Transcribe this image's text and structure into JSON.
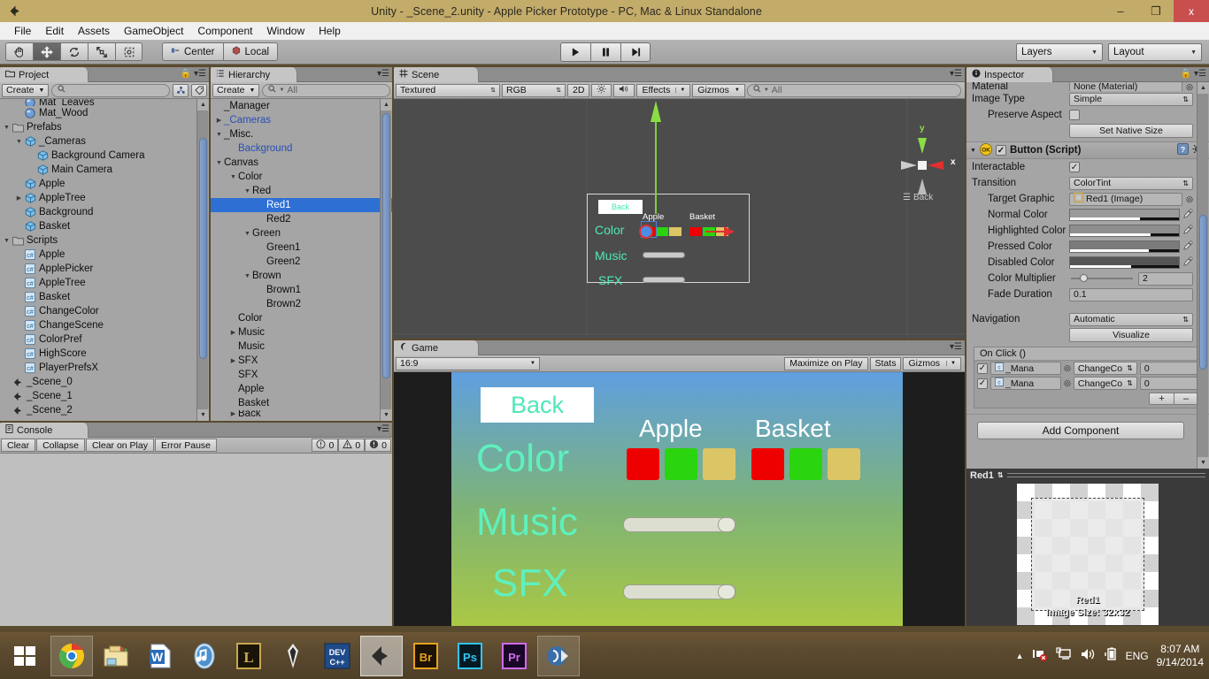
{
  "window": {
    "title": "Unity - _Scene_2.unity - Apple Picker Prototype - PC, Mac & Linux Standalone",
    "minimize": "–",
    "maximize": "❐",
    "close": "x"
  },
  "menubar": {
    "items": [
      "File",
      "Edit",
      "Assets",
      "GameObject",
      "Component",
      "Window",
      "Help"
    ]
  },
  "toolbar": {
    "tools": [
      "hand-tool",
      "move-tool",
      "rotate-tool",
      "scale-tool",
      "rect-tool"
    ],
    "active_tool_index": 1,
    "pivot_mode": "Center",
    "pivot_space": "Local",
    "play": "play-icon",
    "pause": "pause-icon",
    "step": "step-icon",
    "layers": "Layers",
    "layout": "Layout"
  },
  "project": {
    "tab": "Project",
    "create_label": "Create",
    "search_placeholder": "",
    "items": [
      {
        "label": "Mat_Leaves",
        "depth": 1,
        "icon": "material-icon",
        "twirl": "",
        "clipped": true
      },
      {
        "label": "Mat_Wood",
        "depth": 1,
        "icon": "material-icon",
        "twirl": ""
      },
      {
        "label": "Prefabs",
        "depth": 0,
        "icon": "folder-icon",
        "twirl": "▼"
      },
      {
        "label": "_Cameras",
        "depth": 1,
        "icon": "prefab-icon",
        "twirl": "▼"
      },
      {
        "label": "Background Camera",
        "depth": 2,
        "icon": "prefab-icon",
        "twirl": ""
      },
      {
        "label": "Main Camera",
        "depth": 2,
        "icon": "prefab-icon",
        "twirl": ""
      },
      {
        "label": "Apple",
        "depth": 1,
        "icon": "prefab-icon",
        "twirl": ""
      },
      {
        "label": "AppleTree",
        "depth": 1,
        "icon": "prefab-icon",
        "twirl": "▶"
      },
      {
        "label": "Background",
        "depth": 1,
        "icon": "prefab-icon",
        "twirl": ""
      },
      {
        "label": "Basket",
        "depth": 1,
        "icon": "prefab-icon",
        "twirl": ""
      },
      {
        "label": "Scripts",
        "depth": 0,
        "icon": "folder-icon",
        "twirl": "▼"
      },
      {
        "label": "Apple",
        "depth": 1,
        "icon": "csharp-icon",
        "twirl": ""
      },
      {
        "label": "ApplePicker",
        "depth": 1,
        "icon": "csharp-icon",
        "twirl": ""
      },
      {
        "label": "AppleTree",
        "depth": 1,
        "icon": "csharp-icon",
        "twirl": ""
      },
      {
        "label": "Basket",
        "depth": 1,
        "icon": "csharp-icon",
        "twirl": ""
      },
      {
        "label": "ChangeColor",
        "depth": 1,
        "icon": "csharp-icon",
        "twirl": ""
      },
      {
        "label": "ChangeScene",
        "depth": 1,
        "icon": "csharp-icon",
        "twirl": ""
      },
      {
        "label": "ColorPref",
        "depth": 1,
        "icon": "csharp-icon",
        "twirl": ""
      },
      {
        "label": "HighScore",
        "depth": 1,
        "icon": "csharp-icon",
        "twirl": ""
      },
      {
        "label": "PlayerPrefsX",
        "depth": 1,
        "icon": "csharp-icon",
        "twirl": ""
      },
      {
        "label": "_Scene_0",
        "depth": 0,
        "icon": "unity-scene-icon",
        "twirl": ""
      },
      {
        "label": "_Scene_1",
        "depth": 0,
        "icon": "unity-scene-icon",
        "twirl": ""
      },
      {
        "label": "_Scene_2",
        "depth": 0,
        "icon": "unity-scene-icon",
        "twirl": ""
      }
    ]
  },
  "hierarchy": {
    "tab": "Hierarchy",
    "create_label": "Create",
    "search_placeholder": "All",
    "items": [
      {
        "label": "_Manager",
        "depth": 0,
        "twirl": "",
        "style": "normal"
      },
      {
        "label": "_Cameras",
        "depth": 0,
        "twirl": "▶",
        "style": "prefab"
      },
      {
        "label": "_Misc.",
        "depth": 0,
        "twirl": "▼",
        "style": "normal"
      },
      {
        "label": "Background",
        "depth": 1,
        "twirl": "",
        "style": "prefab"
      },
      {
        "label": "Canvas",
        "depth": 0,
        "twirl": "▼",
        "style": "normal"
      },
      {
        "label": "Color",
        "depth": 1,
        "twirl": "▼",
        "style": "normal"
      },
      {
        "label": "Red",
        "depth": 2,
        "twirl": "▼",
        "style": "normal"
      },
      {
        "label": "Red1",
        "depth": 3,
        "twirl": "",
        "style": "normal",
        "selected": true
      },
      {
        "label": "Red2",
        "depth": 3,
        "twirl": "",
        "style": "normal"
      },
      {
        "label": "Green",
        "depth": 2,
        "twirl": "▼",
        "style": "normal"
      },
      {
        "label": "Green1",
        "depth": 3,
        "twirl": "",
        "style": "normal"
      },
      {
        "label": "Green2",
        "depth": 3,
        "twirl": "",
        "style": "normal"
      },
      {
        "label": "Brown",
        "depth": 2,
        "twirl": "▼",
        "style": "normal"
      },
      {
        "label": "Brown1",
        "depth": 3,
        "twirl": "",
        "style": "normal"
      },
      {
        "label": "Brown2",
        "depth": 3,
        "twirl": "",
        "style": "normal"
      },
      {
        "label": "Color",
        "depth": 1,
        "twirl": "",
        "style": "normal"
      },
      {
        "label": "Music",
        "depth": 1,
        "twirl": "▶",
        "style": "normal"
      },
      {
        "label": "Music",
        "depth": 1,
        "twirl": "",
        "style": "normal"
      },
      {
        "label": "SFX",
        "depth": 1,
        "twirl": "▶",
        "style": "normal"
      },
      {
        "label": "SFX",
        "depth": 1,
        "twirl": "",
        "style": "normal"
      },
      {
        "label": "Apple",
        "depth": 1,
        "twirl": "",
        "style": "normal"
      },
      {
        "label": "Basket",
        "depth": 1,
        "twirl": "",
        "style": "normal"
      },
      {
        "label": "Back",
        "depth": 1,
        "twirl": "▶",
        "style": "normal",
        "clipped": true
      }
    ]
  },
  "scene": {
    "tab": "Scene",
    "draw_mode": "Textured",
    "color_mode": "RGB",
    "btn_2d": "2D",
    "light_icon": "sun-icon",
    "audio_icon": "speaker-icon",
    "effects": "Effects",
    "gizmos": "Gizmos",
    "search_placeholder": "All",
    "gizmo_axes": {
      "y": "y",
      "x": "x"
    },
    "gizmo_label": "Back",
    "ui_preview": {
      "back_button": "Back",
      "col_apple": "Apple",
      "col_basket": "Basket",
      "rows": [
        "Color",
        "Music",
        "SFX"
      ]
    }
  },
  "game": {
    "tab": "Game",
    "aspect": "16:9",
    "maximize_on_play": "Maximize on Play",
    "stats": "Stats",
    "gizmos": "Gizmos",
    "content": {
      "back_button": "Back",
      "col_apple": "Apple",
      "col_basket": "Basket",
      "label_color": "Color",
      "label_music": "Music",
      "label_sfx": "SFX",
      "swatches": [
        "#ee0000",
        "#2ad40f",
        "#dcc565"
      ],
      "music_value": 88,
      "sfx_value": 88,
      "text_color": "#5ef0bd"
    }
  },
  "console": {
    "tab": "Console",
    "clear": "Clear",
    "collapse": "Collapse",
    "clear_on_play": "Clear on Play",
    "error_pause": "Error Pause",
    "log_count": "0",
    "warn_count": "0",
    "error_count": "0"
  },
  "inspector": {
    "tab": "Inspector",
    "image_rows": [
      {
        "label": "Material",
        "value": "None (Material)",
        "type": "object"
      },
      {
        "label": "Image Type",
        "value": "Simple",
        "type": "enum"
      },
      {
        "label": "Preserve Aspect",
        "value": "",
        "type": "checkbox",
        "checked": false
      }
    ],
    "set_native_size": "Set Native Size",
    "component": {
      "title": "Button (Script)",
      "enabled": true,
      "icon": "script-ok-icon",
      "help_icon": "help-icon",
      "gear_icon": "gear-icon",
      "rows": [
        {
          "label": "Interactable",
          "type": "checkbox",
          "checked": true
        },
        {
          "label": "Transition",
          "type": "enum",
          "value": "ColorTint"
        },
        {
          "label": "Target Graphic",
          "type": "object",
          "value": "Red1 (Image)",
          "indent": true
        },
        {
          "label": "Normal Color",
          "type": "color",
          "value": "#9a9a9a",
          "indent": true
        },
        {
          "label": "Highlighted Color",
          "type": "color",
          "value": "#8e8e8e",
          "indent": true
        },
        {
          "label": "Pressed Color",
          "type": "color",
          "value": "#7b7b7b",
          "indent": true
        },
        {
          "label": "Disabled Color",
          "type": "color",
          "value": "#555555",
          "indent": true
        },
        {
          "label": "Color Multiplier",
          "type": "slider",
          "value": "2",
          "indent": true
        },
        {
          "label": "Fade Duration",
          "type": "text",
          "value": "0.1",
          "indent": true
        }
      ],
      "navigation_label": "Navigation",
      "navigation_value": "Automatic",
      "visualize": "Visualize",
      "onclick_title": "On Click ()",
      "onclick_rows": [
        {
          "checked": true,
          "object": "_Mana",
          "method": "ChangeCo",
          "arg": "0"
        },
        {
          "checked": true,
          "object": "_Mana",
          "method": "ChangeCo",
          "arg": "0"
        }
      ],
      "plus": "+",
      "minus": "–"
    },
    "add_component": "Add Component",
    "preview": {
      "title": "Red1",
      "asset_name": "Red1",
      "size_text": "Image Size: 32x32"
    }
  },
  "taskbar": {
    "start": "start-icon",
    "apps": [
      {
        "name": "chrome-icon",
        "state": "open"
      },
      {
        "name": "file-explorer-icon",
        "state": "normal"
      },
      {
        "name": "word-icon",
        "state": "normal"
      },
      {
        "name": "itunes-icon",
        "state": "normal"
      },
      {
        "name": "league-of-legends-icon",
        "state": "normal"
      },
      {
        "name": "skyrim-icon",
        "state": "normal"
      },
      {
        "name": "devcpp-icon",
        "state": "normal"
      },
      {
        "name": "unity-icon",
        "state": "active"
      },
      {
        "name": "bridge-icon",
        "state": "normal"
      },
      {
        "name": "photoshop-icon",
        "state": "normal"
      },
      {
        "name": "premiere-icon",
        "state": "normal"
      },
      {
        "name": "monodevelop-icon",
        "state": "open"
      }
    ],
    "tray": {
      "show_hidden": "▲",
      "network_icon": "network-error-icon",
      "display_icon": "display-icon",
      "volume_icon": "volume-icon",
      "battery_icon": "battery-icon",
      "language": "ENG",
      "time": "8:07 AM",
      "date": "9/14/2014"
    }
  }
}
